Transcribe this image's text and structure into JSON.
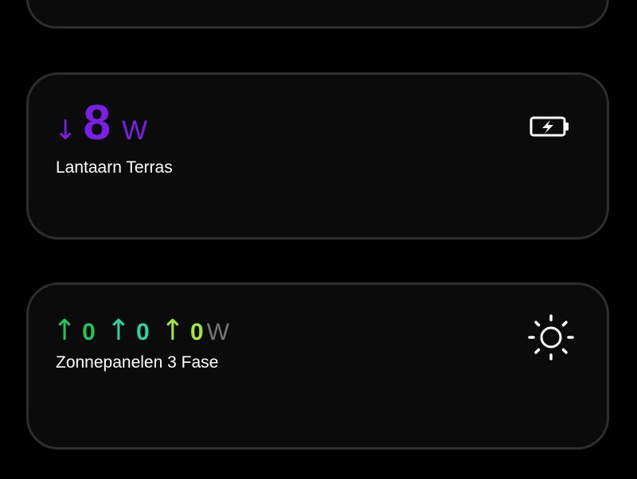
{
  "colors": {
    "background": "#000000",
    "card_bg": "#0b0b0b",
    "card_border": "#2e2e2e",
    "battery_accent": "#7b1fe8",
    "phase1": "#22c55e",
    "phase2": "#2dd4a0",
    "phase3": "#a3e635",
    "unit_grey": "#777777"
  },
  "battery_card": {
    "direction_arrow": "↓",
    "value": "8",
    "unit": "W",
    "label": "Lantaarn Terras",
    "icon": "battery-charging-icon"
  },
  "solar_card": {
    "phases": [
      {
        "arrow": "↑",
        "value": "0"
      },
      {
        "arrow": "↑",
        "value": "0"
      },
      {
        "arrow": "↑",
        "value": "0"
      }
    ],
    "unit": "W",
    "label": "Zonnepanelen 3 Fase",
    "icon": "sun-icon"
  }
}
